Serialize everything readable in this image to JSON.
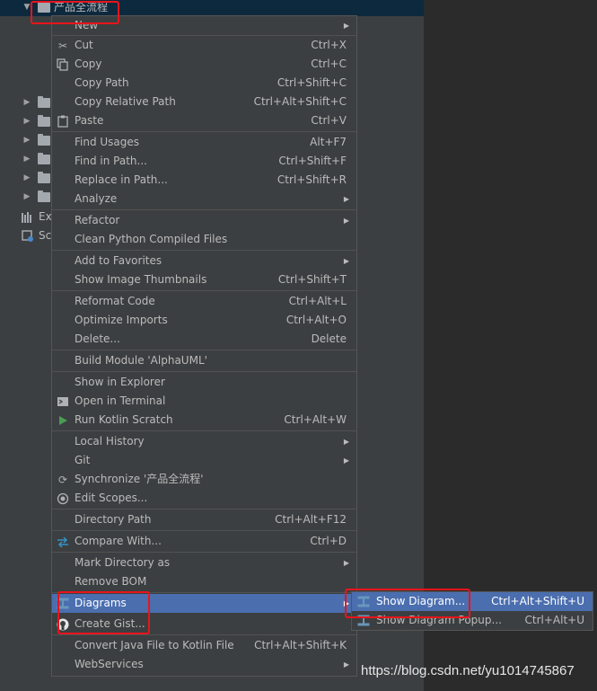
{
  "project_tree": {
    "root_label": "产品全流程",
    "ext_label": "Ext",
    "scratch_label": "Scr"
  },
  "context_menu": {
    "items": [
      {
        "label": "New",
        "shortcut": ""
      },
      {
        "label": "Cut",
        "shortcut": "Ctrl+X"
      },
      {
        "label": "Copy",
        "shortcut": "Ctrl+C"
      },
      {
        "label": "Copy Path",
        "shortcut": "Ctrl+Shift+C"
      },
      {
        "label": "Copy Relative Path",
        "shortcut": "Ctrl+Alt+Shift+C"
      },
      {
        "label": "Paste",
        "shortcut": "Ctrl+V"
      },
      {
        "label": "Find Usages",
        "shortcut": "Alt+F7"
      },
      {
        "label": "Find in Path...",
        "shortcut": "Ctrl+Shift+F"
      },
      {
        "label": "Replace in Path...",
        "shortcut": "Ctrl+Shift+R"
      },
      {
        "label": "Analyze",
        "shortcut": ""
      },
      {
        "label": "Refactor",
        "shortcut": ""
      },
      {
        "label": "Clean Python Compiled Files",
        "shortcut": ""
      },
      {
        "label": "Add to Favorites",
        "shortcut": ""
      },
      {
        "label": "Show Image Thumbnails",
        "shortcut": "Ctrl+Shift+T"
      },
      {
        "label": "Reformat Code",
        "shortcut": "Ctrl+Alt+L"
      },
      {
        "label": "Optimize Imports",
        "shortcut": "Ctrl+Alt+O"
      },
      {
        "label": "Delete...",
        "shortcut": "Delete"
      },
      {
        "label": "Build Module 'AlphaUML'",
        "shortcut": ""
      },
      {
        "label": "Show in Explorer",
        "shortcut": ""
      },
      {
        "label": "Open in Terminal",
        "shortcut": ""
      },
      {
        "label": "Run Kotlin Scratch",
        "shortcut": "Ctrl+Alt+W"
      },
      {
        "label": "Local History",
        "shortcut": ""
      },
      {
        "label": "Git",
        "shortcut": ""
      },
      {
        "label": "Synchronize '产品全流程'",
        "shortcut": ""
      },
      {
        "label": "Edit Scopes...",
        "shortcut": ""
      },
      {
        "label": "Directory Path",
        "shortcut": "Ctrl+Alt+F12"
      },
      {
        "label": "Compare With...",
        "shortcut": "Ctrl+D"
      },
      {
        "label": "Mark Directory as",
        "shortcut": ""
      },
      {
        "label": "Remove BOM",
        "shortcut": ""
      },
      {
        "label": "Diagrams",
        "shortcut": ""
      },
      {
        "label": "Create Gist...",
        "shortcut": ""
      },
      {
        "label": "Convert Java File to Kotlin File",
        "shortcut": "Ctrl+Alt+Shift+K"
      },
      {
        "label": "WebServices",
        "shortcut": ""
      }
    ]
  },
  "diagrams_submenu": {
    "items": [
      {
        "label": "Show Diagram...",
        "shortcut": "Ctrl+Alt+Shift+U"
      },
      {
        "label": "Show Diagram Popup...",
        "shortcut": "Ctrl+Alt+U"
      }
    ]
  },
  "watermark": "https://blog.csdn.net/yu1014745867",
  "colors": {
    "menu_background": "#3c3f41",
    "highlight": "#4b6eaf",
    "annotation_red": "#e8141b",
    "run_icon_green": "#499c54"
  },
  "icons": {
    "cut": "scissors-icon",
    "copy": "copy-icon",
    "paste": "clipboard-icon",
    "terminal": "terminal-icon",
    "run": "run-icon",
    "sync": "sync-icon",
    "scopes": "scope-icon",
    "compare": "compare-arrows-icon",
    "diagrams": "diagram-icon",
    "gist": "github-icon"
  }
}
